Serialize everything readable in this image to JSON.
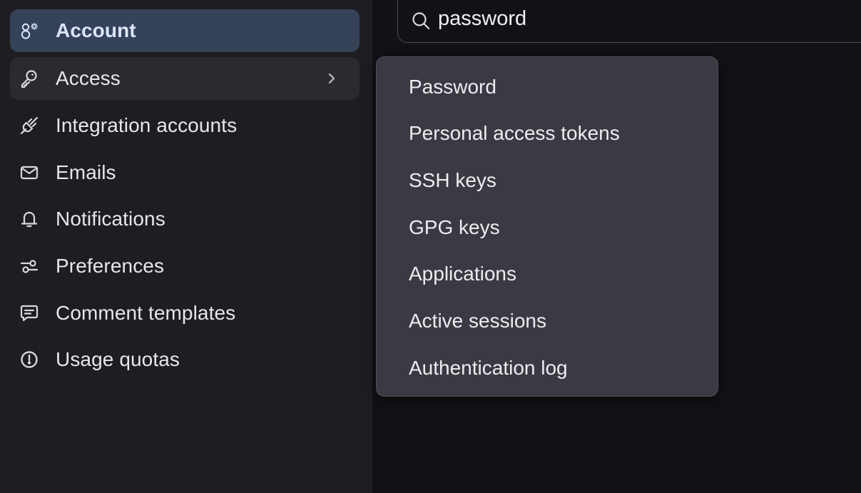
{
  "sidebar": {
    "items": [
      {
        "label": "Account",
        "icon": "account-gear-icon"
      },
      {
        "label": "Access",
        "icon": "key-icon"
      },
      {
        "label": "Integration accounts",
        "icon": "plug-icon"
      },
      {
        "label": "Emails",
        "icon": "envelope-icon"
      },
      {
        "label": "Notifications",
        "icon": "bell-icon"
      },
      {
        "label": "Preferences",
        "icon": "sliders-icon"
      },
      {
        "label": "Comment templates",
        "icon": "comment-icon"
      },
      {
        "label": "Usage quotas",
        "icon": "gauge-icon"
      }
    ],
    "active_item": "Account",
    "expanded_item": "Access"
  },
  "search": {
    "value": "password"
  },
  "submenu": {
    "items": [
      {
        "label": "Password"
      },
      {
        "label": "Personal access tokens"
      },
      {
        "label": "SSH keys"
      },
      {
        "label": "GPG keys"
      },
      {
        "label": "Applications"
      },
      {
        "label": "Active sessions"
      },
      {
        "label": "Authentication log"
      }
    ]
  },
  "colors": {
    "background": "#121216",
    "sidebar": "#1d1d22",
    "active_item": "#354258",
    "hover_item": "#2a2a30",
    "dropdown": "#3a3a42",
    "text": "#ececf1"
  }
}
